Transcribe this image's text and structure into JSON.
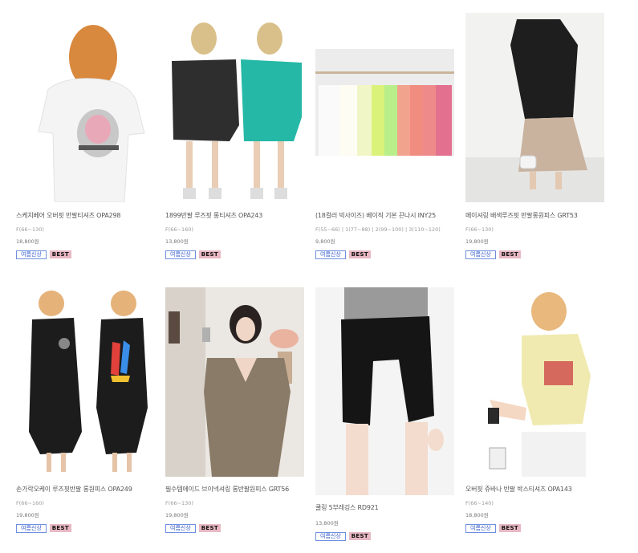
{
  "products": [
    {
      "name": "스케치베어 오버핏 반팔티셔츠 OPA298",
      "size": "F(66~130)",
      "price": "18,800원",
      "badge_new": "여름신상",
      "badge_best": "BEST",
      "image": "white-tshirt-dress-photo"
    },
    {
      "name": "1899반팔 루즈핏 롱티셔츠 OPA243",
      "size": "F(66~160)",
      "price": "13,800원",
      "badge_new": "여름신상",
      "badge_best": "BEST",
      "image": "black-and-teal-tshirt-photo"
    },
    {
      "name": "(18컬러 빅사이즈) 베이직 기본 끈나시 INY25",
      "size": "F(55~66) | 1(77~88) | 2(99~100) | 3(110~120)",
      "price": "9,800원",
      "badge_new": "여름신상",
      "badge_best": "BEST",
      "image": "camisoles-on-hangers-photo"
    },
    {
      "name": "메이셔링 배색루즈핏 반팔롱원피스 GRT53",
      "size": "F(66~130)",
      "price": "19,800원",
      "badge_new": "여름신상",
      "badge_best": "BEST",
      "image": "black-beige-long-dress-photo"
    },
    {
      "name": "손가락오케이 루즈핏반팔 롱원피스 OPA249",
      "size": "F(66~160)",
      "price": "19,800원",
      "badge_new": "여름신상",
      "badge_best": "BEST",
      "image": "black-long-dress-photo"
    },
    {
      "name": "필수템에이드 브이넥셔링 롱반팔원피스 GRT56",
      "size": "F(66~130)",
      "price": "19,800원",
      "badge_new": "여름신상",
      "badge_best": "BEST",
      "image": "khaki-vneck-dress-photo"
    },
    {
      "name": "쿨링 5부레깅스 RD921",
      "size": "",
      "price": "13,800원",
      "badge_new": "여름신상",
      "badge_best": "BEST",
      "image": "black-leggings-photo"
    },
    {
      "name": "오버핏 쥬바나 반팔 박스티셔츠 OPA143",
      "size": "F(66~140)",
      "price": "18,800원",
      "badge_new": "여름신상",
      "badge_best": "BEST",
      "image": "yellow-tshirt-photo"
    }
  ]
}
